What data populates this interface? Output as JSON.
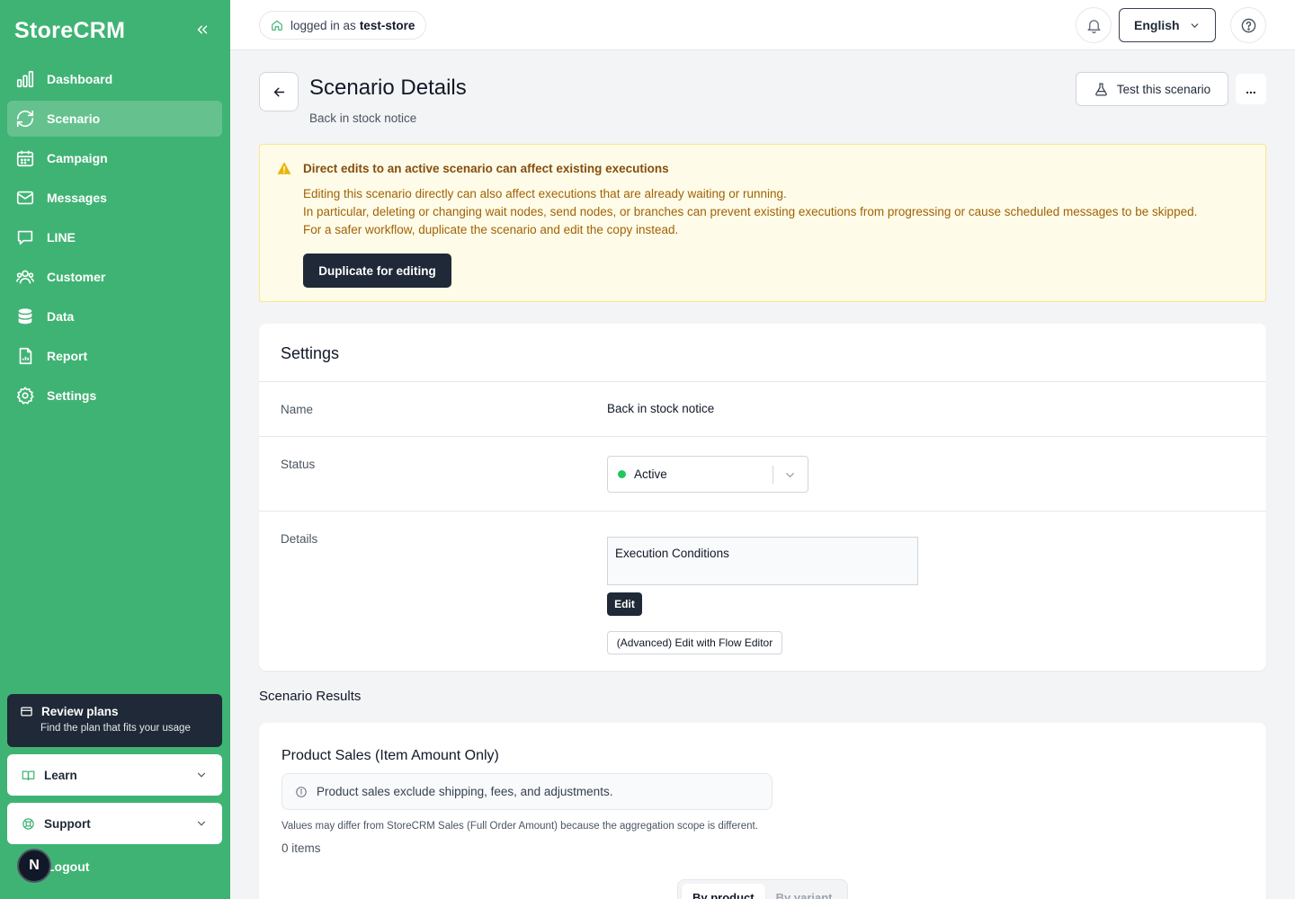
{
  "sidebar": {
    "brand": "StoreCRM",
    "items": [
      {
        "label": "Dashboard",
        "icon": "bar-chart-icon"
      },
      {
        "label": "Scenario",
        "icon": "refresh-icon",
        "active": true
      },
      {
        "label": "Campaign",
        "icon": "calendar-icon"
      },
      {
        "label": "Messages",
        "icon": "mail-icon"
      },
      {
        "label": "LINE",
        "icon": "chat-icon"
      },
      {
        "label": "Customer",
        "icon": "users-icon"
      },
      {
        "label": "Data",
        "icon": "database-icon"
      },
      {
        "label": "Report",
        "icon": "file-chart-icon"
      },
      {
        "label": "Settings",
        "icon": "gear-icon"
      }
    ],
    "review": {
      "title": "Review plans",
      "subtitle": "Find the plan that fits your usage"
    },
    "learn": "Learn",
    "support": "Support",
    "logout": "Logout",
    "avatar_initial": "N"
  },
  "header": {
    "login_prefix": "logged in as",
    "store": "test-store",
    "language": "English"
  },
  "page": {
    "title": "Scenario Details",
    "subtitle": "Back in stock notice",
    "test_button": "Test this scenario",
    "more_button": "..."
  },
  "warning": {
    "title": "Direct edits to an active scenario can affect existing executions",
    "line1": "Editing this scenario directly can also affect executions that are already waiting or running.",
    "line2": "In particular, deleting or changing wait nodes, send nodes, or branches can prevent existing executions from progressing or cause scheduled messages to be skipped.",
    "line3": "For a safer workflow, duplicate the scenario and edit the copy instead.",
    "button": "Duplicate for editing"
  },
  "settings": {
    "title": "Settings",
    "name_label": "Name",
    "name_value": "Back in stock notice",
    "status_label": "Status",
    "status_value": "Active",
    "status_color": "#22c55e",
    "details_label": "Details",
    "conditions_title": "Execution Conditions",
    "edit_button": "Edit",
    "flow_button": "(Advanced) Edit with Flow Editor"
  },
  "results": {
    "title": "Scenario Results",
    "card_title": "Product Sales (Item Amount Only)",
    "info": "Product sales exclude shipping, fees, and adjustments.",
    "note": "Values may differ from StoreCRM Sales (Full Order Amount) because the aggregation scope is different.",
    "count": "0 items",
    "tabs": [
      "By product",
      "By variant"
    ]
  },
  "colors": {
    "sidebar": "#3fb373",
    "dark": "#1f2937",
    "warning_bg": "#fefce8"
  }
}
